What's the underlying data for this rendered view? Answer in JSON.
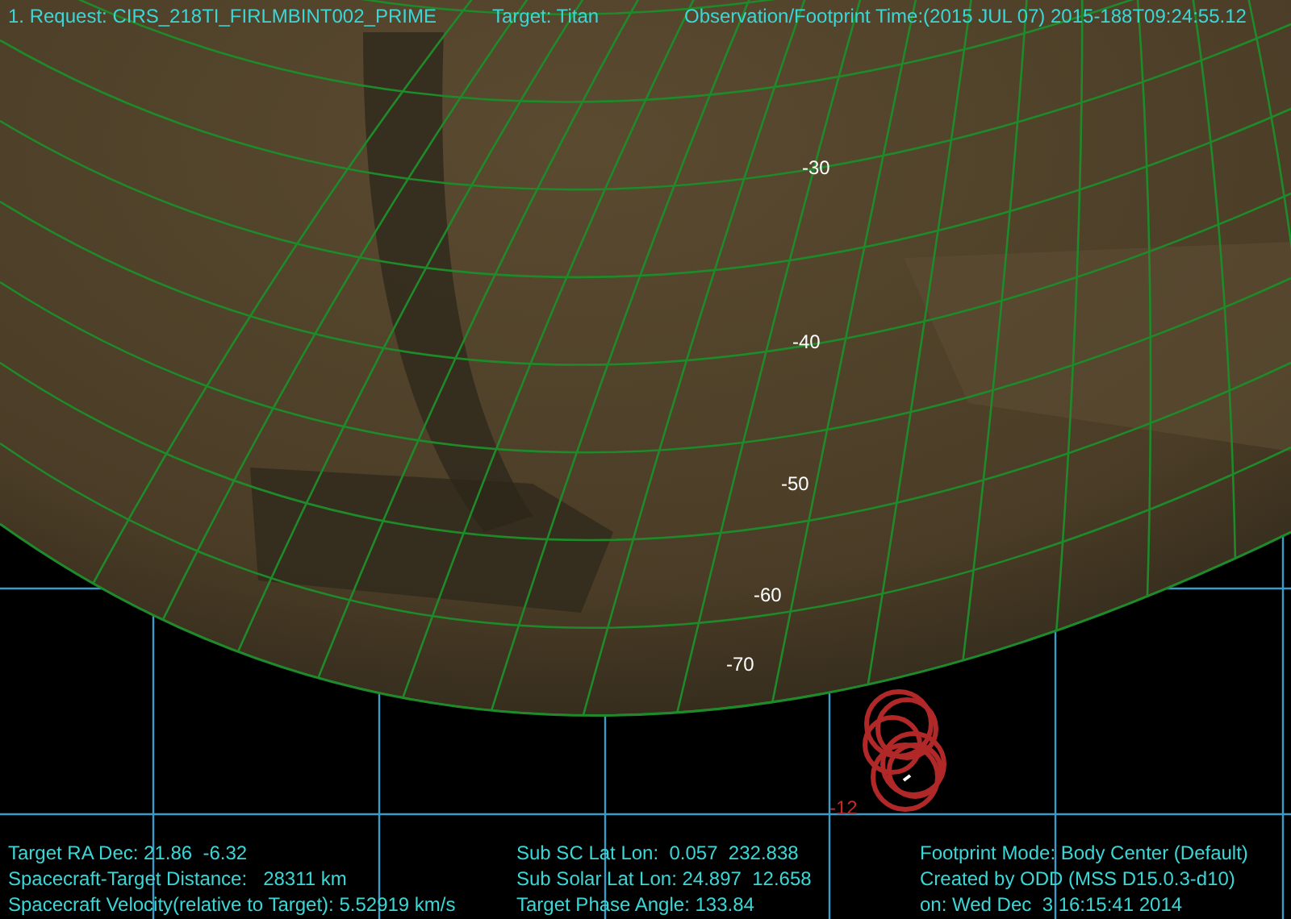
{
  "header": {
    "request": "1. Request: CIRS_218TI_FIRLMBINT002_PRIME",
    "target": "Target: Titan",
    "time": "Observation/Footprint Time:(2015 JUL 07) 2015-188T09:24:55.12"
  },
  "latitude_labels": [
    "-30",
    "-40",
    "-50",
    "-60",
    "-70"
  ],
  "declination_label": "-12",
  "info_columns": [
    [
      "Target RA Dec: 21.86  -6.32",
      "Spacecraft-Target Distance:   28311 km",
      "Spacecraft Velocity(relative to Target): 5.52919 km/s"
    ],
    [
      "Sub SC Lat Lon:  0.057  232.838",
      "Sub Solar Lat Lon: 24.897  12.658",
      "Target Phase Angle: 133.84"
    ],
    [
      "Footprint Mode: Body Center (Default)",
      "Created by ODD (MSS D15.0.3-d10)",
      "on: Wed Dec  3 16:15:41 2014"
    ]
  ]
}
